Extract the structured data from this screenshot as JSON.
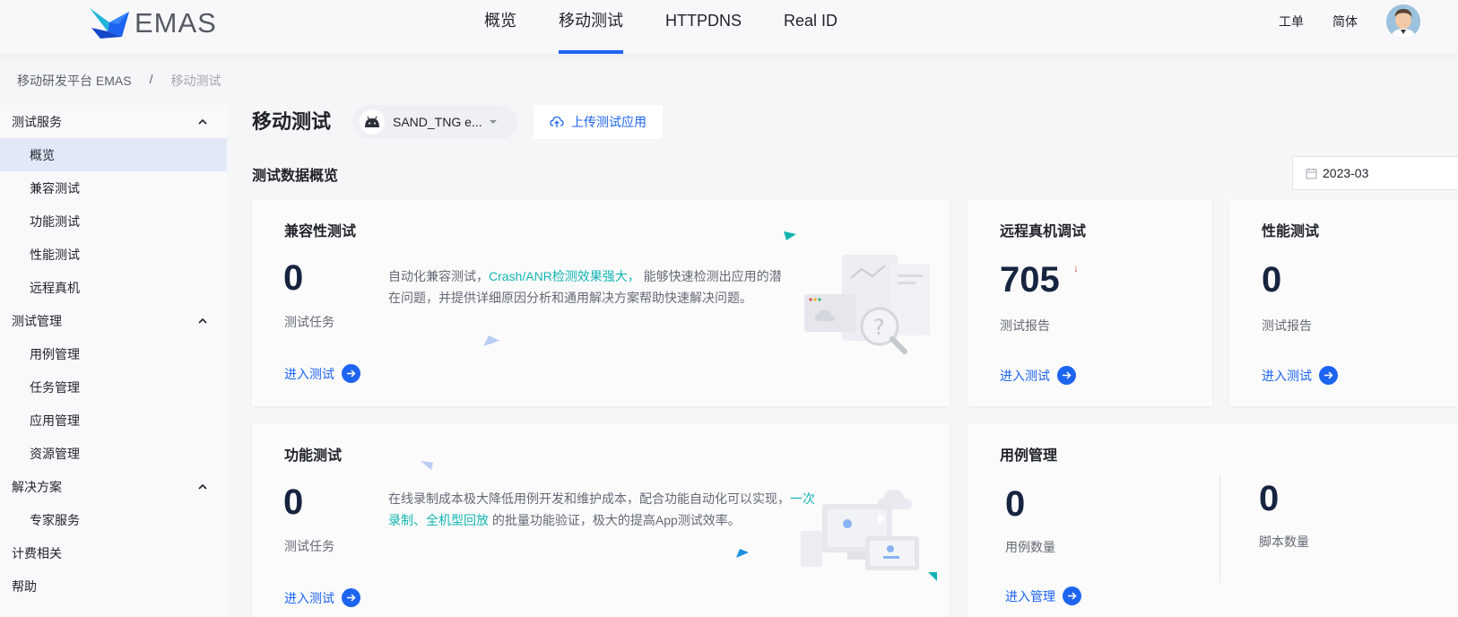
{
  "header": {
    "logo_text": "EMAS",
    "nav": [
      {
        "label": "概览",
        "active": false
      },
      {
        "label": "移动测试",
        "active": true
      },
      {
        "label": "HTTPDNS",
        "active": false
      },
      {
        "label": "Real ID",
        "active": false
      }
    ],
    "ticket_label": "工单",
    "lang_label": "简体"
  },
  "breadcrumb": {
    "root": "移动研发平台 EMAS",
    "sep": "/",
    "current": "移动测试"
  },
  "sidebar": {
    "groups": [
      {
        "label": "测试服务",
        "items": [
          "概览",
          "兼容测试",
          "功能测试",
          "性能测试",
          "远程真机"
        ]
      },
      {
        "label": "测试管理",
        "items": [
          "用例管理",
          "任务管理",
          "应用管理",
          "资源管理"
        ]
      },
      {
        "label": "解决方案",
        "items": [
          "专家服务"
        ]
      }
    ],
    "active_item": "概览",
    "billing_label": "计费相关",
    "help_label": "帮助"
  },
  "main": {
    "title": "移动测试",
    "app_name": "SAND_TNG e...",
    "upload_label": "上传测试应用",
    "section_title": "测试数据概览",
    "date_value": "2023-03"
  },
  "cards": {
    "compat": {
      "title": "兼容性测试",
      "value": "0",
      "label": "测试任务",
      "desc_pre": "自动化兼容测试，",
      "desc_hl": "Crash/ANR检测效果强大，",
      "desc_post1": " 能够快速检测出应用的潜",
      "desc_line2": "在问题，并提供详细原因分析和通用解决方案帮助快速解决问题。",
      "enter": "进入测试"
    },
    "remote": {
      "title": "远程真机调试",
      "value": "705",
      "label": "测试报告",
      "enter": "进入测试",
      "trend": "↓"
    },
    "perf": {
      "title": "性能测试",
      "value": "0",
      "label": "测试报告",
      "enter": "进入测试"
    },
    "func": {
      "title": "功能测试",
      "value": "0",
      "label": "测试任务",
      "desc_pre": "在线录制成本极大降低用例开发和维护成本，配合功能自动化可以实现，",
      "desc_hl1": "一次",
      "desc_hl2": "录制、全机型回放",
      "desc_post": " 的批量功能验证，极大的提高App测试效率。",
      "enter": "进入测试"
    },
    "cases": {
      "title": "用例管理",
      "case_value": "0",
      "case_label": "用例数量",
      "script_value": "0",
      "script_label": "脚本数量",
      "enter": "进入管理"
    }
  },
  "colors": {
    "accent": "#1d64f0",
    "highlight": "#13b5b1",
    "trend_down": "#e5484d"
  }
}
